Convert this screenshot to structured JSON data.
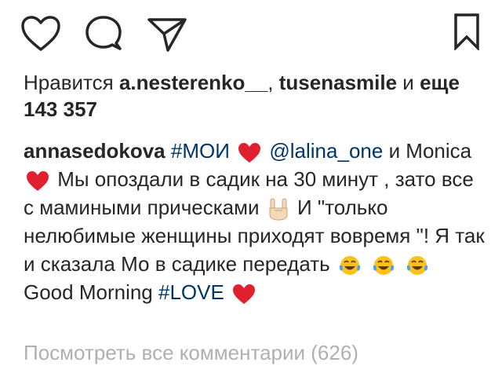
{
  "actions": {
    "like_icon": "heart-outline-icon",
    "comment_icon": "speech-bubble-icon",
    "share_icon": "paper-plane-icon",
    "save_icon": "bookmark-icon"
  },
  "likes": {
    "prefix": "Нравится",
    "user1": "a.nesterenko__",
    "sep": ",",
    "user2": "tusenasmile",
    "and": "и",
    "count_text": "еще 143 357"
  },
  "caption": {
    "author": "annasedokova",
    "hashtag1": "#МОИ",
    "mention": "@lalina_one",
    "text1": "и Monica",
    "text2": "Мы опоздали в садик на 30 минут , зато все с мамиными прическами",
    "text3": "И \"только нелюбимые женщины приходят вовремя \"! Я  так и сказала Мо в садике передать",
    "text4": "Good Morning",
    "hashtag2": "#LOVE"
  },
  "comments": {
    "view_all": "Посмотреть все комментарии (626)"
  },
  "colors": {
    "text": "#262626",
    "link": "#003569",
    "heart_emoji": "#e0202f",
    "muted": "#b0b0b0"
  }
}
